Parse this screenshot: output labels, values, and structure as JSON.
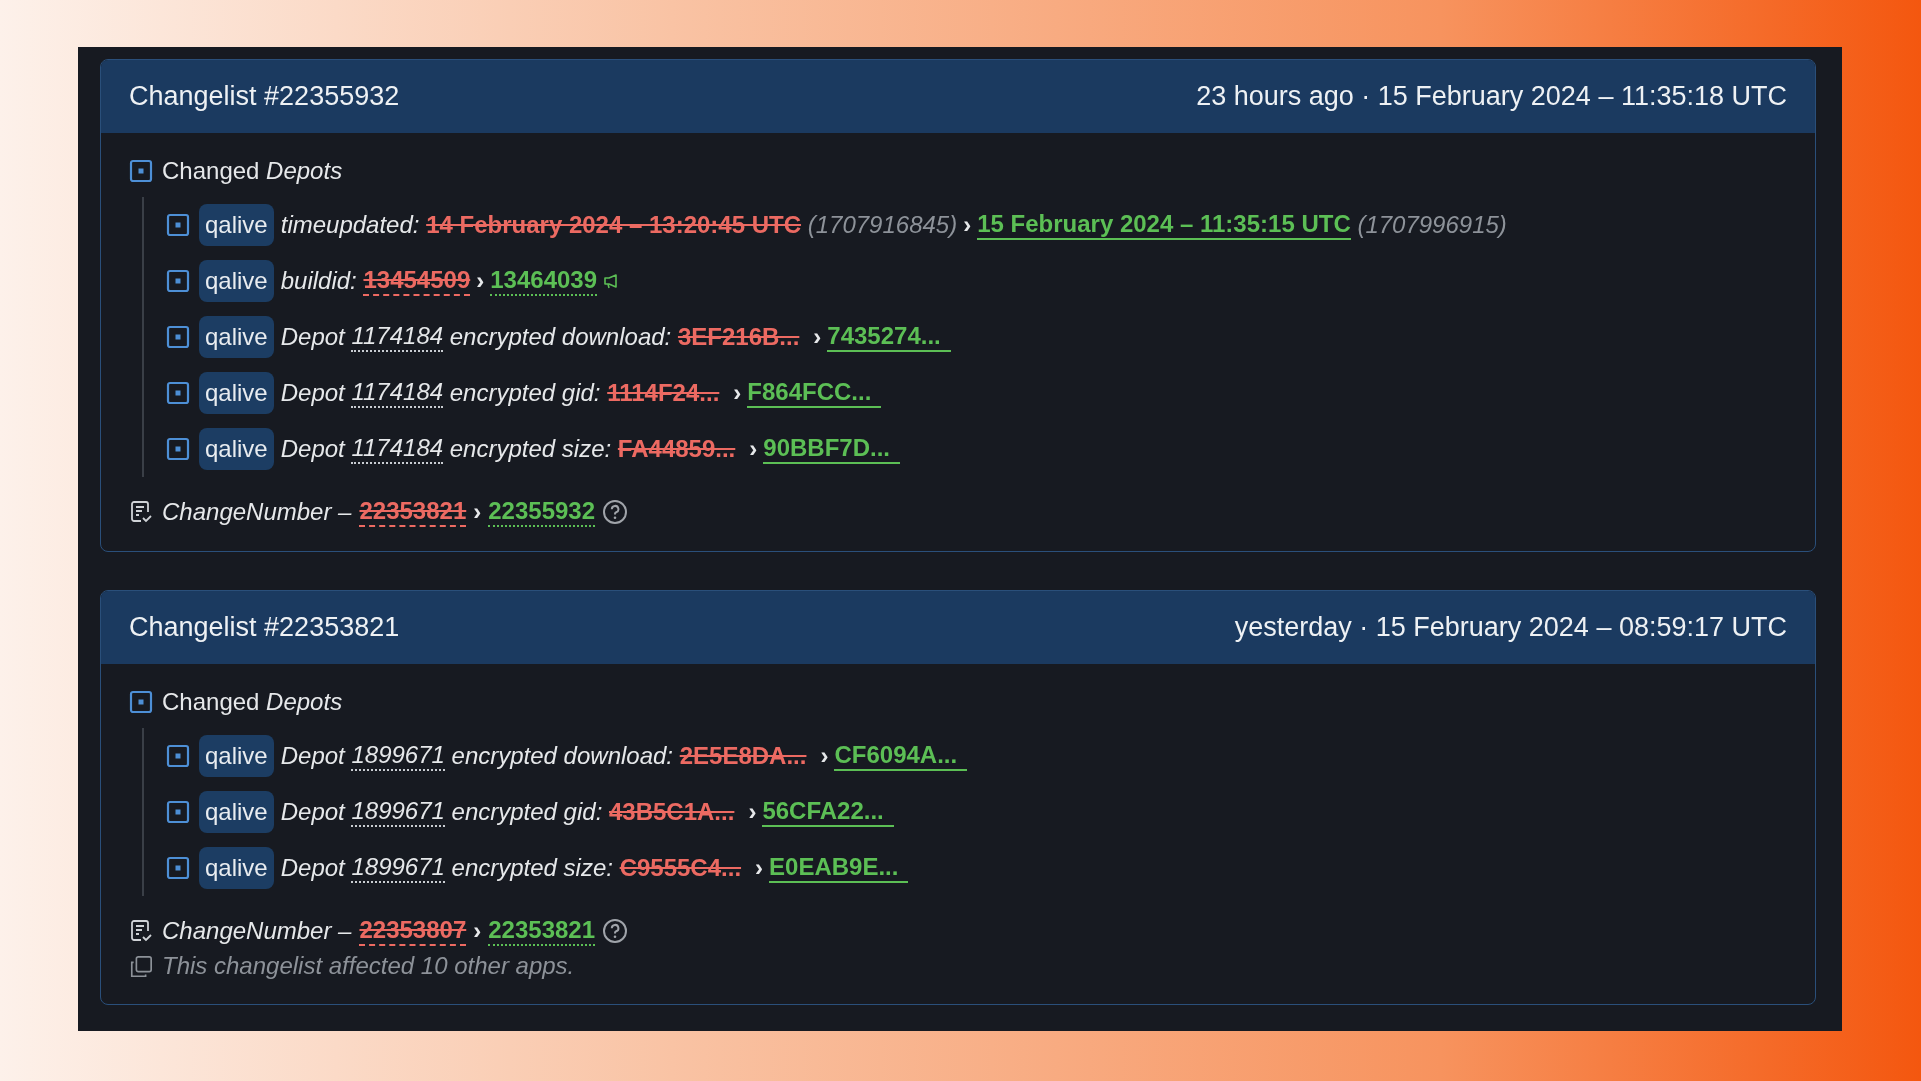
{
  "changelists": [
    {
      "title": "Changelist #22355932",
      "time": "23 hours ago · 15 February 2024 – 11:35:18 UTC",
      "section": "Changed *Depots*",
      "rows": [
        {
          "kind": "time",
          "branch": "qalive",
          "key": "timeupdated:",
          "old": "14 February 2024 – 13:20:45 UTC",
          "old_note": "(1707916845)",
          "arrow": "›",
          "new": "15 February 2024 – 11:35:15 UTC",
          "new_note": "(1707996915)"
        },
        {
          "kind": "number",
          "branch": "qalive",
          "key": "buildid:",
          "old": "13454509",
          "arrow": "›",
          "new": "13464039",
          "announce": true
        },
        {
          "kind": "depot",
          "branch": "qalive",
          "key": "Depot",
          "depot": "1174184",
          "field": "encrypted download:",
          "old": "3EF216B...",
          "arrow": "›",
          "new": "7435274..."
        },
        {
          "kind": "depot",
          "branch": "qalive",
          "key": "Depot",
          "depot": "1174184",
          "field": "encrypted gid:",
          "old": "1114F24...",
          "arrow": "›",
          "new": "F864FCC..."
        },
        {
          "kind": "depot",
          "branch": "qalive",
          "key": "Depot",
          "depot": "1174184",
          "field": "encrypted size:",
          "old": "FA44859...",
          "arrow": "›",
          "new": "90BBF7D..."
        }
      ],
      "change_number": {
        "label": "ChangeNumber –",
        "old": "22353821",
        "arrow": "›",
        "new": "22355932"
      }
    },
    {
      "title": "Changelist #22353821",
      "time": "yesterday · 15 February 2024 – 08:59:17 UTC",
      "section": "Changed *Depots*",
      "rows": [
        {
          "kind": "depot",
          "branch": "qalive",
          "key": "Depot",
          "depot": "1899671",
          "field": "encrypted download:",
          "old": "2E5E8DA...",
          "arrow": "›",
          "new": "CF6094A..."
        },
        {
          "kind": "depot",
          "branch": "qalive",
          "key": "Depot",
          "depot": "1899671",
          "field": "encrypted gid:",
          "old": "43B5C1A...",
          "arrow": "›",
          "new": "56CFA22..."
        },
        {
          "kind": "depot",
          "branch": "qalive",
          "key": "Depot",
          "depot": "1899671",
          "field": "encrypted size:",
          "old": "C9555C4...",
          "arrow": "›",
          "new": "E0EAB9E..."
        }
      ],
      "change_number": {
        "label": "ChangeNumber –",
        "old": "22353807",
        "arrow": "›",
        "new": "22353821"
      },
      "note": "This changelist affected 10 other apps."
    }
  ]
}
